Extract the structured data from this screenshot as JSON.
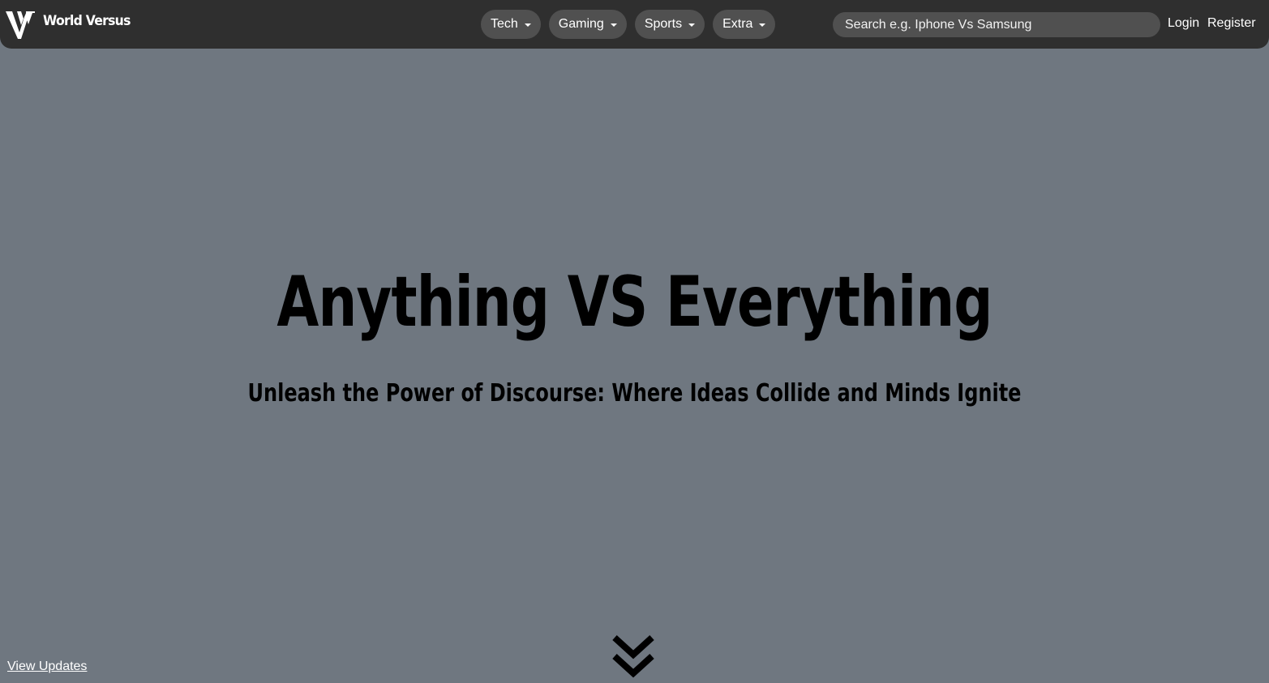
{
  "brand": {
    "name": "World Versus",
    "logo_icon": "wv-monogram-icon"
  },
  "nav": {
    "menus": [
      {
        "label": "Tech",
        "icon": "caret-down-icon"
      },
      {
        "label": "Gaming",
        "icon": "caret-down-icon"
      },
      {
        "label": "Sports",
        "icon": "caret-down-icon"
      },
      {
        "label": "Extra",
        "icon": "caret-down-icon"
      }
    ],
    "search": {
      "placeholder": "Search e.g. Iphone Vs Samsung",
      "value": ""
    },
    "login_label": "Login",
    "register_label": "Register"
  },
  "hero": {
    "title": "Anything VS Everything",
    "subtitle": "Unleash the Power of Discourse: Where Ideas Collide and Minds Ignite",
    "scroll_icon": "double-chevron-down-icon"
  },
  "footer": {
    "view_updates_label": "View Updates"
  },
  "colors": {
    "page_background": "#6f7780",
    "navbar_background": "#2f2f2f",
    "pill_background": "#505050",
    "text_light": "#ffffff",
    "text_dark": "#000000"
  }
}
